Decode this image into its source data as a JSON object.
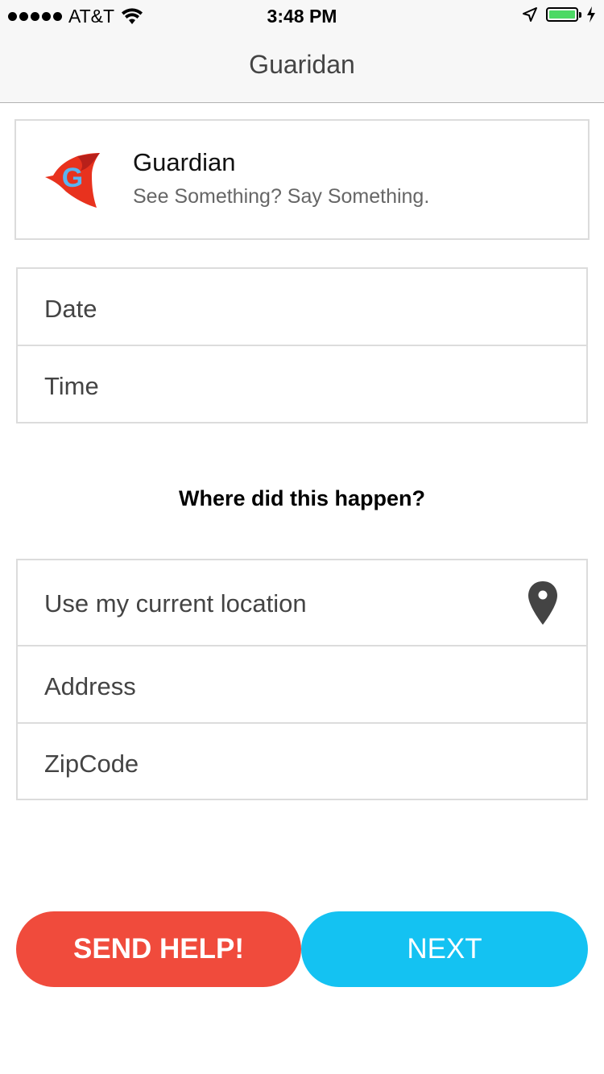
{
  "status_bar": {
    "carrier": "AT&T",
    "time": "3:48 PM",
    "battery_color": "#4cd964"
  },
  "nav": {
    "title": "Guaridan"
  },
  "header": {
    "app_name": "Guardian",
    "tagline": "See Something? Say Something.",
    "logo_letter": "G"
  },
  "fields": {
    "date_label": "Date",
    "time_label": "Time"
  },
  "location": {
    "heading": "Where did this happen?",
    "current_location_label": "Use my current location",
    "current_location_icon": "map-pin-icon",
    "address_label": "Address",
    "zipcode_label": "ZipCode"
  },
  "actions": {
    "send_help_label": "SEND HELP!",
    "send_help_color": "#f04b3c",
    "next_label": "NEXT",
    "next_color": "#14c2f2"
  }
}
